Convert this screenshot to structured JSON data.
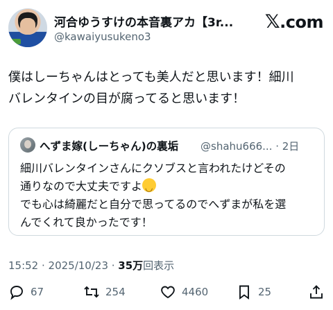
{
  "author": {
    "display_name": "河合ゆうすけの本音裏アカ【3r...",
    "handle": "@kawaiyusukeno3"
  },
  "brand": {
    "logo_text": ".com",
    "logo_symbol": "𝕏"
  },
  "tweet": {
    "line1": "僕はしーちゃんはとっても美人だと思います！細川",
    "line2": "バレンタインの目が腐ってると思います！"
  },
  "quote": {
    "display_name": "へずま嫁(しーちゃん)の裏垢",
    "handle_and_time": "@shahu666... · 2日",
    "line1": "細川バレンタインさんにクソブスと言われたけどその",
    "line2": "通りなので大丈夫ですよ",
    "line3": "でも心は綺麗だと自分で思ってるのでへずまが私を選",
    "line4": "んでくれて良かったです！"
  },
  "meta": {
    "timestamp": "15:52 · 2025/10/23 · ",
    "views_count": "35万",
    "views_label": "回表示"
  },
  "actions": {
    "replies": "67",
    "retweets": "254",
    "likes": "4460",
    "bookmarks": "25"
  },
  "colors": {
    "text": "#0f1419",
    "secondary": "#536471",
    "border": "#cfd9de"
  }
}
